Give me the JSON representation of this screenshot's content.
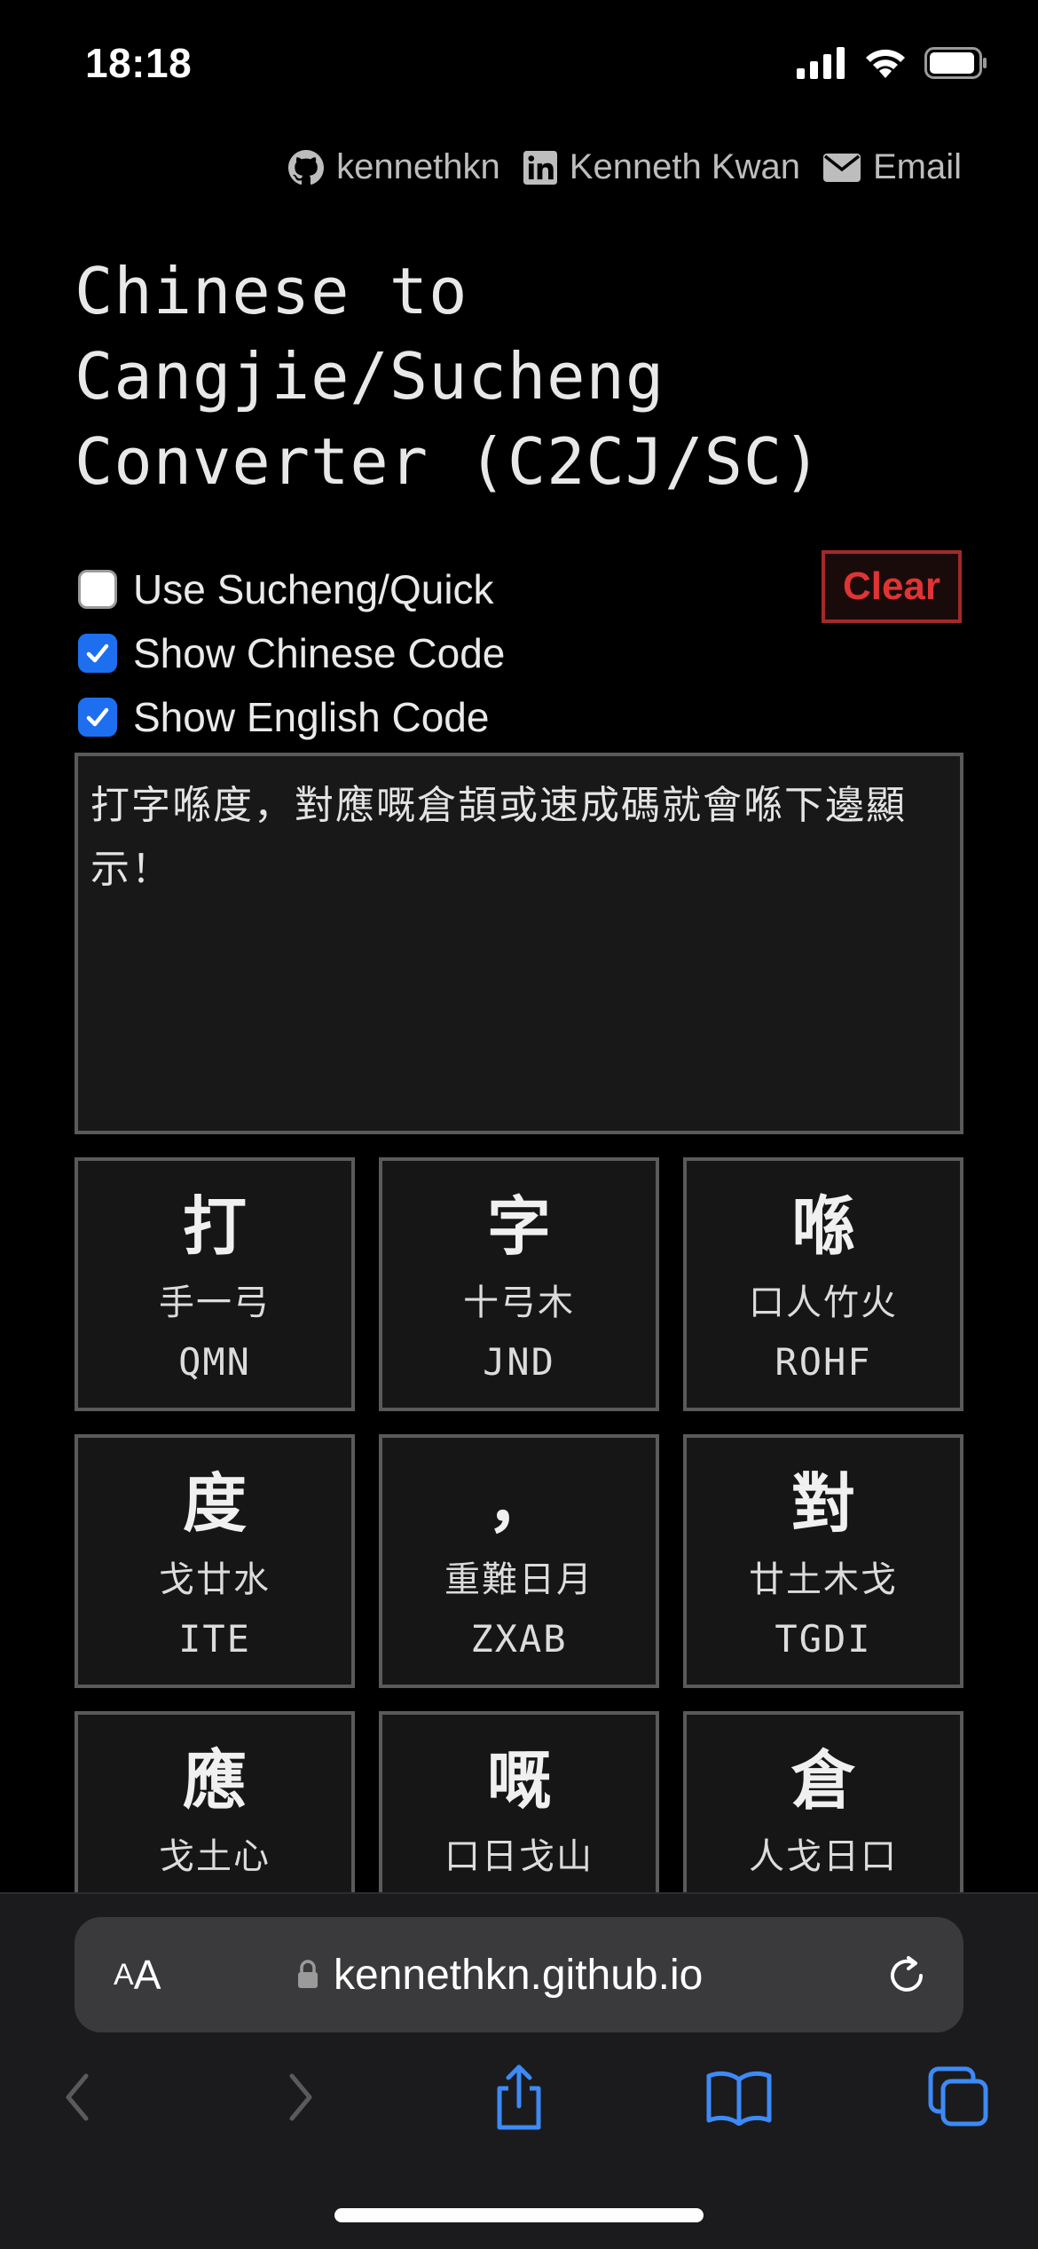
{
  "status": {
    "time": "18:18"
  },
  "header": {
    "links": [
      {
        "icon": "github-icon",
        "label": "kennethkn"
      },
      {
        "icon": "linkedin-icon",
        "label": "Kenneth Kwan"
      },
      {
        "icon": "mail-icon",
        "label": "Email"
      }
    ]
  },
  "title": {
    "line1": "Chinese to",
    "line2": "Cangjie/Sucheng",
    "line3": "Converter (C2CJ/SC)"
  },
  "options": [
    {
      "label": "Use Sucheng/Quick",
      "checked": false
    },
    {
      "label": "Show Chinese Code",
      "checked": true
    },
    {
      "label": "Show English Code",
      "checked": true
    }
  ],
  "clear_label": "Clear",
  "input_text": "打字喺度，對應嘅倉頡或速成碼就會喺下邊顯示！",
  "cards": [
    {
      "char": "打",
      "zh": "手一弓",
      "en": "QMN"
    },
    {
      "char": "字",
      "zh": "十弓木",
      "en": "JND"
    },
    {
      "char": "喺",
      "zh": "口人竹火",
      "en": "ROHF"
    },
    {
      "char": "度",
      "zh": "戈廿水",
      "en": "ITE"
    },
    {
      "char": "，",
      "zh": "重難日月",
      "en": "ZXAB"
    },
    {
      "char": "對",
      "zh": "廿土木戈",
      "en": "TGDI"
    },
    {
      "char": "應",
      "zh": "戈土心",
      "en": ""
    },
    {
      "char": "嘅",
      "zh": "口日戈山",
      "en": ""
    },
    {
      "char": "倉",
      "zh": "人戈日口",
      "en": ""
    }
  ],
  "browser": {
    "aa_small": "A",
    "aa_big": "A",
    "url": "kennethkn.github.io"
  },
  "colors": {
    "accent_blue": "#1e6ff0",
    "clear_red": "#e03434",
    "toolbar_blue": "#3d8af7"
  }
}
